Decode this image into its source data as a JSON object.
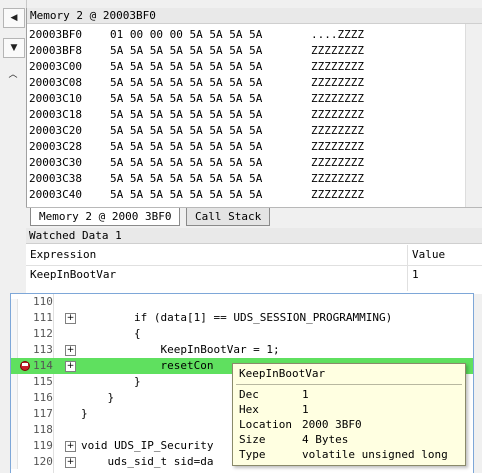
{
  "colors": {
    "exec_highlight": "#5fe05f",
    "breakpoint": "#c8202b",
    "tooltip_bg": "#ffffe1"
  },
  "left_strip": {
    "buttons": [
      {
        "icon": "tab-nav-triangle-icon",
        "glyph": "◀"
      },
      {
        "icon": "dropdown-arrow-icon",
        "glyph": "▼"
      },
      {
        "icon": "chevron-up-icon",
        "glyph": "︿"
      }
    ]
  },
  "memory": {
    "title": "Memory 2 @ 20003BF0",
    "rows": [
      {
        "addr": "20003BF0",
        "bytes": "01 00 00 00 5A 5A 5A 5A",
        "ascii": "....ZZZZ"
      },
      {
        "addr": "20003BF8",
        "bytes": "5A 5A 5A 5A 5A 5A 5A 5A",
        "ascii": "ZZZZZZZZ"
      },
      {
        "addr": "20003C00",
        "bytes": "5A 5A 5A 5A 5A 5A 5A 5A",
        "ascii": "ZZZZZZZZ"
      },
      {
        "addr": "20003C08",
        "bytes": "5A 5A 5A 5A 5A 5A 5A 5A",
        "ascii": "ZZZZZZZZ"
      },
      {
        "addr": "20003C10",
        "bytes": "5A 5A 5A 5A 5A 5A 5A 5A",
        "ascii": "ZZZZZZZZ"
      },
      {
        "addr": "20003C18",
        "bytes": "5A 5A 5A 5A 5A 5A 5A 5A",
        "ascii": "ZZZZZZZZ"
      },
      {
        "addr": "20003C20",
        "bytes": "5A 5A 5A 5A 5A 5A 5A 5A",
        "ascii": "ZZZZZZZZ"
      },
      {
        "addr": "20003C28",
        "bytes": "5A 5A 5A 5A 5A 5A 5A 5A",
        "ascii": "ZZZZZZZZ"
      },
      {
        "addr": "20003C30",
        "bytes": "5A 5A 5A 5A 5A 5A 5A 5A",
        "ascii": "ZZZZZZZZ"
      },
      {
        "addr": "20003C38",
        "bytes": "5A 5A 5A 5A 5A 5A 5A 5A",
        "ascii": "ZZZZZZZZ"
      },
      {
        "addr": "20003C40",
        "bytes": "5A 5A 5A 5A 5A 5A 5A 5A",
        "ascii": "ZZZZZZZZ"
      }
    ],
    "tabs": [
      {
        "label": "Memory 2 @ 2000 3BF0",
        "active": true
      },
      {
        "label": "Call Stack",
        "active": false
      }
    ]
  },
  "watch": {
    "title": "Watched Data 1",
    "columns": {
      "expression": "Expression",
      "value": "Value"
    },
    "rows": [
      {
        "expression": "KeepInBootVar",
        "value": "1"
      }
    ]
  },
  "code": {
    "lines": [
      {
        "num": "110",
        "text": "",
        "expander": ""
      },
      {
        "num": "111",
        "text": "        if (data[1] == UDS_SESSION_PROGRAMMING)",
        "expander": "+"
      },
      {
        "num": "112",
        "text": "        {",
        "expander": ""
      },
      {
        "num": "113",
        "text": "            KeepInBootVar = 1;",
        "expander": "+"
      },
      {
        "num": "114",
        "text": "            resetCon",
        "expander": "+",
        "highlight": true,
        "breakpoint": true
      },
      {
        "num": "115",
        "text": "        }",
        "expander": ""
      },
      {
        "num": "116",
        "text": "    }",
        "expander": ""
      },
      {
        "num": "117",
        "text": "}",
        "expander": ""
      },
      {
        "num": "118",
        "text": "",
        "expander": ""
      },
      {
        "num": "119",
        "text": "void UDS_IP_Security",
        "expander": "+"
      },
      {
        "num": "120",
        "text": "    uds_sid_t sid=da",
        "expander": "+"
      }
    ]
  },
  "tooltip": {
    "title": "KeepInBootVar",
    "rows": [
      {
        "key": "Dec",
        "value": "1"
      },
      {
        "key": "Hex",
        "value": "1"
      },
      {
        "key": "Location",
        "value": "2000 3BF0"
      },
      {
        "key": "Size",
        "value": "4 Bytes"
      },
      {
        "key": "Type",
        "value": "volatile unsigned long"
      }
    ]
  }
}
